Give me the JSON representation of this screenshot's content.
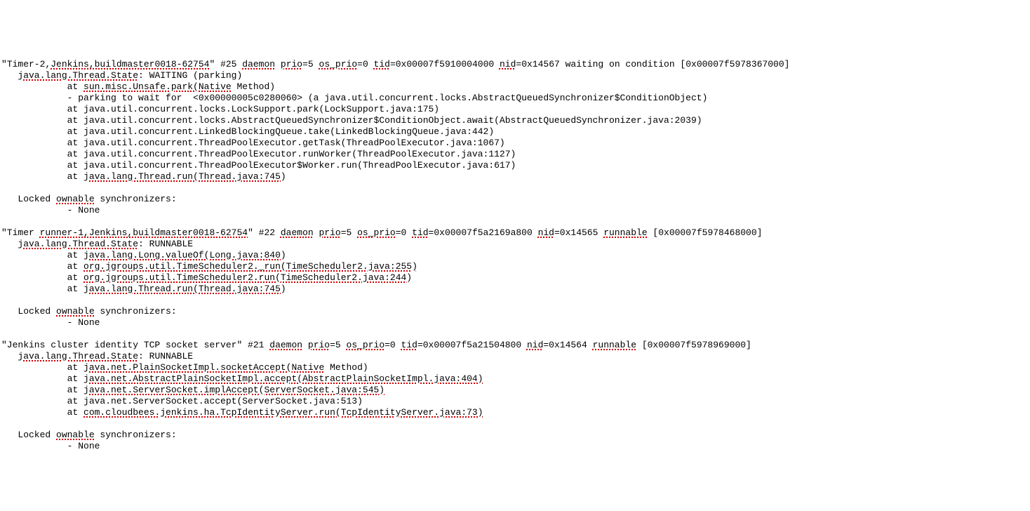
{
  "threads": [
    {
      "header": "\"Timer-2,Jenkins,buildmaster0018-62754\" #25 daemon prio=5 os_prio=0 tid=0x00007f5910004000 nid=0x14567 waiting on condition [0x00007f5978367000]",
      "sp_header": [
        "Jenkins,buildmaster0018-62754",
        "daemon",
        "prio",
        "os_prio",
        "tid",
        "nid"
      ],
      "state": "   java.lang.Thread.State: WAITING (parking)",
      "sp_state": [
        "java.lang.Thread.State"
      ],
      "frames": [
        {
          "text": "            at sun.misc.Unsafe.park(Native Method)",
          "sp": [
            "sun.misc.Unsafe.park(Native"
          ]
        },
        {
          "text": "            - parking to wait for  <0x00000005c0280060> (a java.util.concurrent.locks.AbstractQueuedSynchronizer$ConditionObject)",
          "sp": []
        },
        {
          "text": "            at java.util.concurrent.locks.LockSupport.park(LockSupport.java:175)",
          "sp": []
        },
        {
          "text": "            at java.util.concurrent.locks.AbstractQueuedSynchronizer$ConditionObject.await(AbstractQueuedSynchronizer.java:2039)",
          "sp": []
        },
        {
          "text": "            at java.util.concurrent.LinkedBlockingQueue.take(LinkedBlockingQueue.java:442)",
          "sp": []
        },
        {
          "text": "            at java.util.concurrent.ThreadPoolExecutor.getTask(ThreadPoolExecutor.java:1067)",
          "sp": []
        },
        {
          "text": "            at java.util.concurrent.ThreadPoolExecutor.runWorker(ThreadPoolExecutor.java:1127)",
          "sp": []
        },
        {
          "text": "            at java.util.concurrent.ThreadPoolExecutor$Worker.run(ThreadPoolExecutor.java:617)",
          "sp": []
        },
        {
          "text": "            at java.lang.Thread.run(Thread.java:745)",
          "sp": [
            "java.lang.Thread.run(Thread.java:745)"
          ]
        }
      ],
      "locked_header": "   Locked ownable synchronizers:",
      "sp_locked": [
        "ownable"
      ],
      "locked_items": [
        {
          "text": "            - None"
        }
      ]
    },
    {
      "header": "\"Timer runner-1,Jenkins,buildmaster0018-62754\" #22 daemon prio=5 os_prio=0 tid=0x00007f5a2169a800 nid=0x14565 runnable [0x00007f5978468000]",
      "sp_header": [
        "runner-1,Jenkins,buildmaster0018-62754",
        "daemon",
        "prio",
        "os_prio",
        "tid",
        "nid",
        "runnable"
      ],
      "state": "   java.lang.Thread.State: RUNNABLE",
      "sp_state": [
        "java.lang.Thread.State"
      ],
      "frames": [
        {
          "text": "            at java.lang.Long.valueOf(Long.java:840)",
          "sp": [
            "java.lang.Long.valueOf(Long.java:840)"
          ]
        },
        {
          "text": "            at org.jgroups.util.TimeScheduler2._run(TimeScheduler2.java:255)",
          "sp": [
            "org.jgroups.util.TimeScheduler2._run(TimeScheduler2.java:255)"
          ]
        },
        {
          "text": "            at org.jgroups.util.TimeScheduler2.run(TimeScheduler2.java:244)",
          "sp": [
            "org.jgroups.util.TimeScheduler2.run(TimeScheduler2.java:244)"
          ]
        },
        {
          "text": "            at java.lang.Thread.run(Thread.java:745)",
          "sp": [
            "java.lang.Thread.run(Thread.java:745)"
          ]
        }
      ],
      "locked_header": "   Locked ownable synchronizers:",
      "sp_locked": [
        "ownable"
      ],
      "locked_items": [
        {
          "text": "            - None"
        }
      ]
    },
    {
      "header": "\"Jenkins cluster identity TCP socket server\" #21 daemon prio=5 os_prio=0 tid=0x00007f5a21504800 nid=0x14564 runnable [0x00007f5978969000]",
      "sp_header": [
        "daemon",
        "prio",
        "os_prio",
        "tid",
        "nid",
        "runnable"
      ],
      "state": "   java.lang.Thread.State: RUNNABLE",
      "sp_state": [
        "java.lang.Thread.State"
      ],
      "frames": [
        {
          "text": "            at java.net.PlainSocketImpl.socketAccept(Native Method)",
          "sp": [
            "java.net.PlainSocketImpl.socketAccept(Native"
          ]
        },
        {
          "text": "            at java.net.AbstractPlainSocketImpl.accept(AbstractPlainSocketImpl.java:404)",
          "sp": [
            "java.net.AbstractPlainSocketImpl.accept(AbstractPlainSocketImpl.java:404)"
          ]
        },
        {
          "text": "            at java.net.ServerSocket.implAccept(ServerSocket.java:545)",
          "sp": [
            "java.net.ServerSocket.implAccept(ServerSocket.java:545)"
          ]
        },
        {
          "text": "            at java.net.ServerSocket.accept(ServerSocket.java:513)",
          "sp": []
        },
        {
          "text": "            at com.cloudbees.jenkins.ha.TcpIdentityServer.run(TcpIdentityServer.java:73)",
          "sp": [
            "com.cloudbees.jenkins.ha.TcpIdentityServer.run(TcpIdentityServer.java:73)"
          ]
        }
      ],
      "locked_header": "   Locked ownable synchronizers:",
      "sp_locked": [
        "ownable"
      ],
      "locked_items": [
        {
          "text": "            - None"
        }
      ]
    }
  ]
}
